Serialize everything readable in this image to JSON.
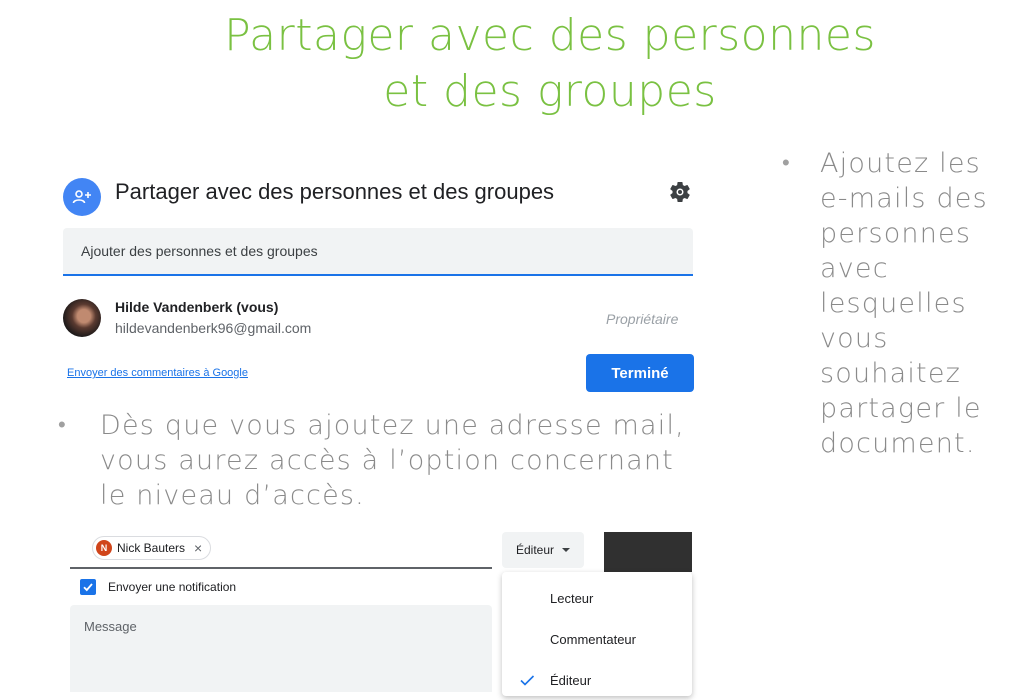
{
  "slide": {
    "title_line1": "Partager avec des personnes",
    "title_line2": "et des groupes",
    "bullet_right": "Ajoutez les e-mails des personnes avec lesquelles vous souhaitez partager le document.",
    "bullet_mid": "Dès que vous ajoutez une adresse mail, vous aurez accès à l’option concernant le niveau d’accès.",
    "bullet_symbol": "•"
  },
  "dialog": {
    "title": "Partager avec des personnes et des groupes",
    "add_placeholder": "Ajouter des personnes et des groupes",
    "user_name": "Hilde Vandenberk (vous)",
    "user_email": "hildevandenberk96@gmail.com",
    "owner_role": "Propriétaire",
    "feedback_link": "Envoyer des commentaires à Google",
    "done_button": "Terminé"
  },
  "access": {
    "chip_initial": "N",
    "chip_name": "Nick Bauters",
    "chip_remove": "×",
    "role_selected": "Éditeur",
    "notify_label": "Envoyer une notification",
    "notify_checked": true,
    "message_placeholder": "Message",
    "menu_options": [
      {
        "label": "Lecteur",
        "selected": false
      },
      {
        "label": "Commentateur",
        "selected": false
      },
      {
        "label": "Éditeur",
        "selected": true
      }
    ]
  },
  "colors": {
    "title_green": "#7ac142",
    "accent_blue": "#1a73e8",
    "bullet_gray": "#8a8a8a"
  },
  "icons": {
    "add_person": "add-person-icon",
    "settings": "gear-icon",
    "check": "check-icon",
    "dropdown": "caret-down-icon"
  }
}
